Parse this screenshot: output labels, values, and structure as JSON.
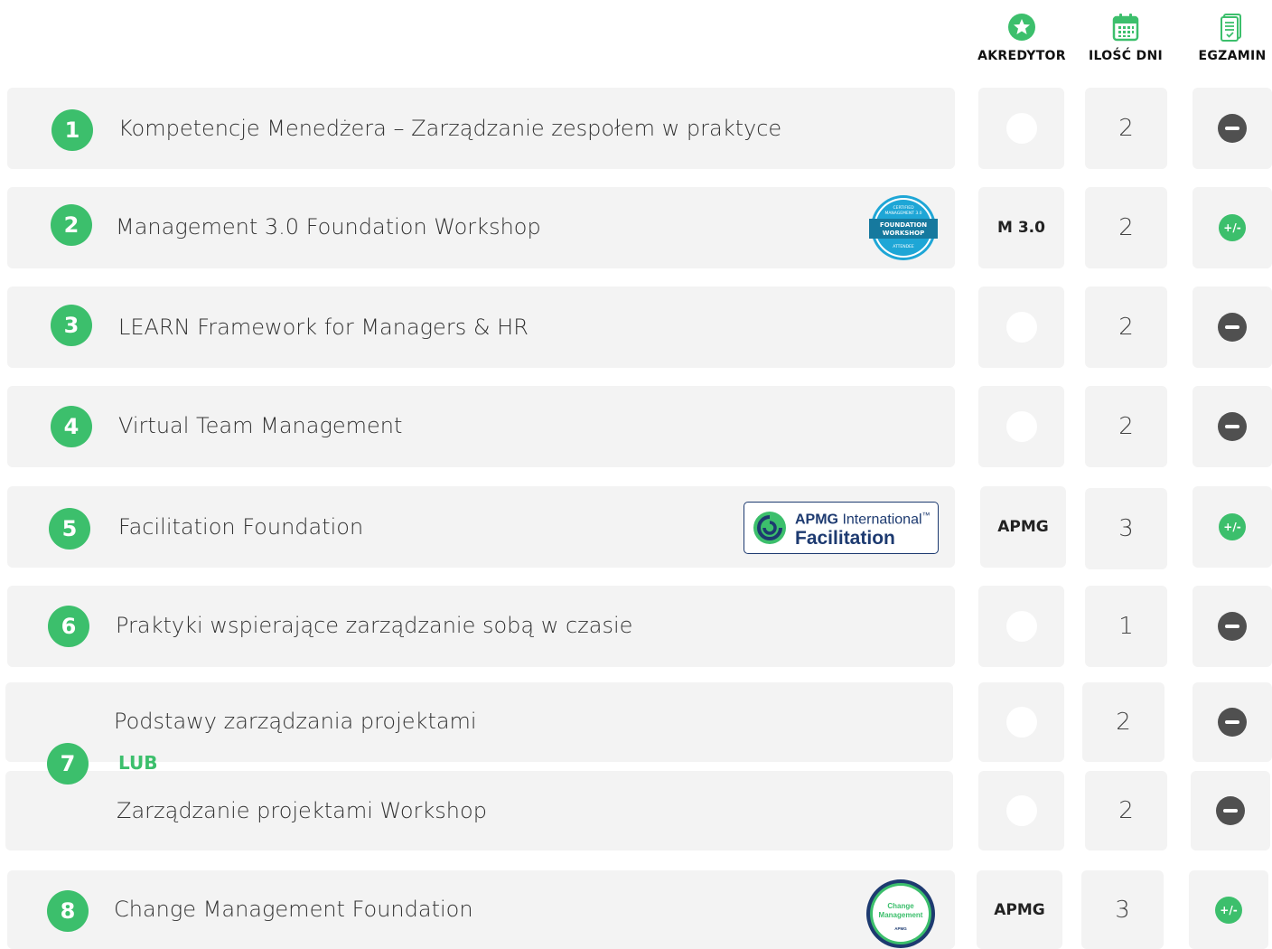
{
  "header": {
    "akredytor": "AKREDYTOR",
    "ilosc_dni": "ILOŚĆ DNI",
    "egzamin": "EGZAMIN"
  },
  "rows": [
    {
      "number": "1",
      "title": "Kompetencje Menedżera – Zarządzanie zespołem w praktyce",
      "akredytor": "",
      "days": "2",
      "exam": "minus"
    },
    {
      "number": "2",
      "title": "Management 3.0 Foundation Workshop",
      "akredytor": "M 3.0",
      "days": "2",
      "exam": "plus-minus",
      "badge": "management-3-0-badge"
    },
    {
      "number": "3",
      "title": "LEARN Framework for Managers & HR",
      "akredytor": "",
      "days": "2",
      "exam": "minus"
    },
    {
      "number": "4",
      "title": "Virtual Team Management",
      "akredytor": "",
      "days": "2",
      "exam": "minus"
    },
    {
      "number": "5",
      "title": "Facilitation Foundation",
      "akredytor": "APMG",
      "days": "3",
      "exam": "plus-minus",
      "badge": "apmg-facilitation-badge"
    },
    {
      "number": "6",
      "title": "Praktyki wspierające zarządzanie sobą w czasie",
      "akredytor": "",
      "days": "1",
      "exam": "minus"
    },
    {
      "number": "7",
      "title": "Podstawy zarządzania projektami",
      "akredytor": "",
      "days": "2",
      "exam": "minus"
    },
    {
      "number": "7",
      "title": "Zarządzanie projektami Workshop",
      "akredytor": "",
      "days": "2",
      "exam": "minus"
    },
    {
      "number": "8",
      "title": "Change Management Foundation",
      "akredytor": "APMG",
      "days": "3",
      "exam": "plus-minus",
      "badge": "change-management-badge"
    }
  ],
  "or_label": "LUB",
  "plus_minus_glyph": "+/-",
  "badges": {
    "m30": {
      "line1": "CERTIFIED",
      "line2": "MANAGEMENT 3.0",
      "line3": "FOUNDATION",
      "line4": "WORKSHOP",
      "line5": "ATTENDEE"
    },
    "apmg": {
      "brand": "APMG",
      "brand_rest": "International",
      "tm": "™",
      "product": "Facilitation"
    },
    "cm": {
      "line1": "Change",
      "line2": "Management",
      "line3": "APMG"
    }
  },
  "colors": {
    "accent_green": "#3cbf6c",
    "card_bg": "#f3f3f3",
    "minus_gray": "#505050",
    "apmg_navy": "#1d3a70",
    "m30_blue": "#1ea6d6"
  }
}
